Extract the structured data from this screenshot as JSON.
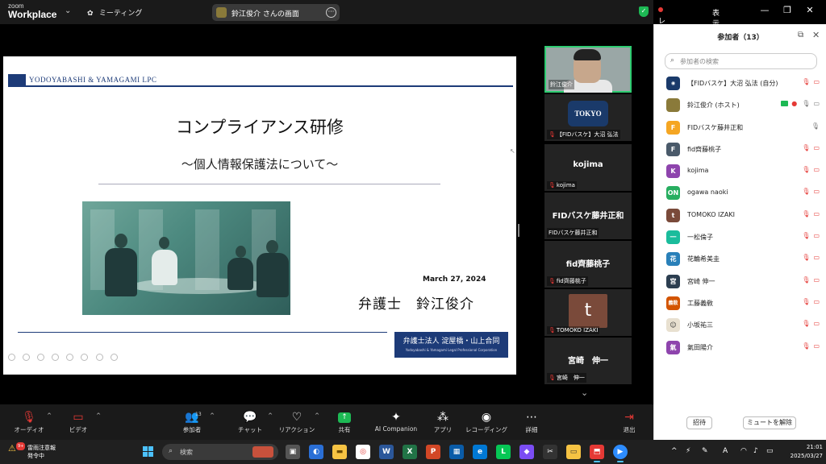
{
  "titlebar": {
    "brand_small": "zoom",
    "brand_big": "Workplace",
    "meeting_label": "ミーティング",
    "share_label": "鈴江俊介 さんの画面",
    "recording_label": "レコーディング",
    "view_label": "表示"
  },
  "slide": {
    "firm_header": "YODOYABASHI & YAMAGAMI LPC",
    "title": "コンプライアンス研修",
    "subtitle": "～個人情報保護法について～",
    "date": "March 27, 2024",
    "presenter": "弁護士　鈴江俊介",
    "footer_jp": "弁護士法人 淀屋橋・山上合同",
    "footer_en": "Yodoyabashi & Yamagami Legal Professional Corporation"
  },
  "video_tiles": [
    {
      "name": "鈴江俊介",
      "big": "",
      "type": "camera"
    },
    {
      "name": "【FIDバスケ】大沼  弘法",
      "big": "TOKYO",
      "type": "logo"
    },
    {
      "name": "kojima",
      "big": "kojima",
      "type": "name"
    },
    {
      "name": "FIDバスケ藤井正和",
      "big": "FIDバスケ藤井正和",
      "type": "name"
    },
    {
      "name": "fid齊藤桃子",
      "big": "fid齊藤桃子",
      "type": "name"
    },
    {
      "name": "TOMOKO IZAKI",
      "big": "t",
      "type": "avatar"
    },
    {
      "name": "宮崎　伸一",
      "big": "宮崎　伸一",
      "type": "name"
    }
  ],
  "panel": {
    "title": "参加者（13）",
    "search_placeholder": "参加者の検索",
    "invite_label": "招待",
    "unmute_label": "ミュートを解除"
  },
  "participants": [
    {
      "avatar": "",
      "name": "【FIDバスケ】大沼  弘法 (自分)",
      "color": "#1a3a6a"
    },
    {
      "avatar": "",
      "name": "鈴江俊介 (ホスト)",
      "color": "#8a7a3a"
    },
    {
      "avatar": "F",
      "name": "FIDバスケ藤井正和",
      "color": "#f5a623"
    },
    {
      "avatar": "F",
      "name": "fid齊藤桃子",
      "color": "#4a5a6a"
    },
    {
      "avatar": "K",
      "name": "kojima",
      "color": "#8e44ad"
    },
    {
      "avatar": "ON",
      "name": "ogawa naoki",
      "color": "#27ae60"
    },
    {
      "avatar": "t",
      "name": "TOMOKO IZAKI",
      "color": "#7a4a3a"
    },
    {
      "avatar": "一",
      "name": "一松倫子",
      "color": "#1abc9c"
    },
    {
      "avatar": "花",
      "name": "花輪希美圭",
      "color": "#2980b9"
    },
    {
      "avatar": "宮",
      "name": "宮崎  伸一",
      "color": "#2c3e50"
    },
    {
      "avatar": "義敎",
      "name": "工藤義敎",
      "color": "#d35400"
    },
    {
      "avatar": "",
      "name": "小坂祐三",
      "color": "#e8e0d0"
    },
    {
      "avatar": "氣",
      "name": "氣田陽介",
      "color": "#8e44ad"
    }
  ],
  "toolbar": {
    "audio": "オーディオ",
    "video": "ビデオ",
    "participants": "参加者",
    "participants_count": "13",
    "chat": "チャット",
    "reactions": "リアクション",
    "share": "共有",
    "ai": "AI Companion",
    "apps": "アプリ",
    "record": "レコーディング",
    "more": "詳細",
    "leave": "退出"
  },
  "taskbar": {
    "weather_line1": "雷雨注意報",
    "weather_line2": "発令中",
    "weather_badge": "9+",
    "search_placeholder": "検索",
    "time": "21:01",
    "date": "2025/03/27"
  }
}
